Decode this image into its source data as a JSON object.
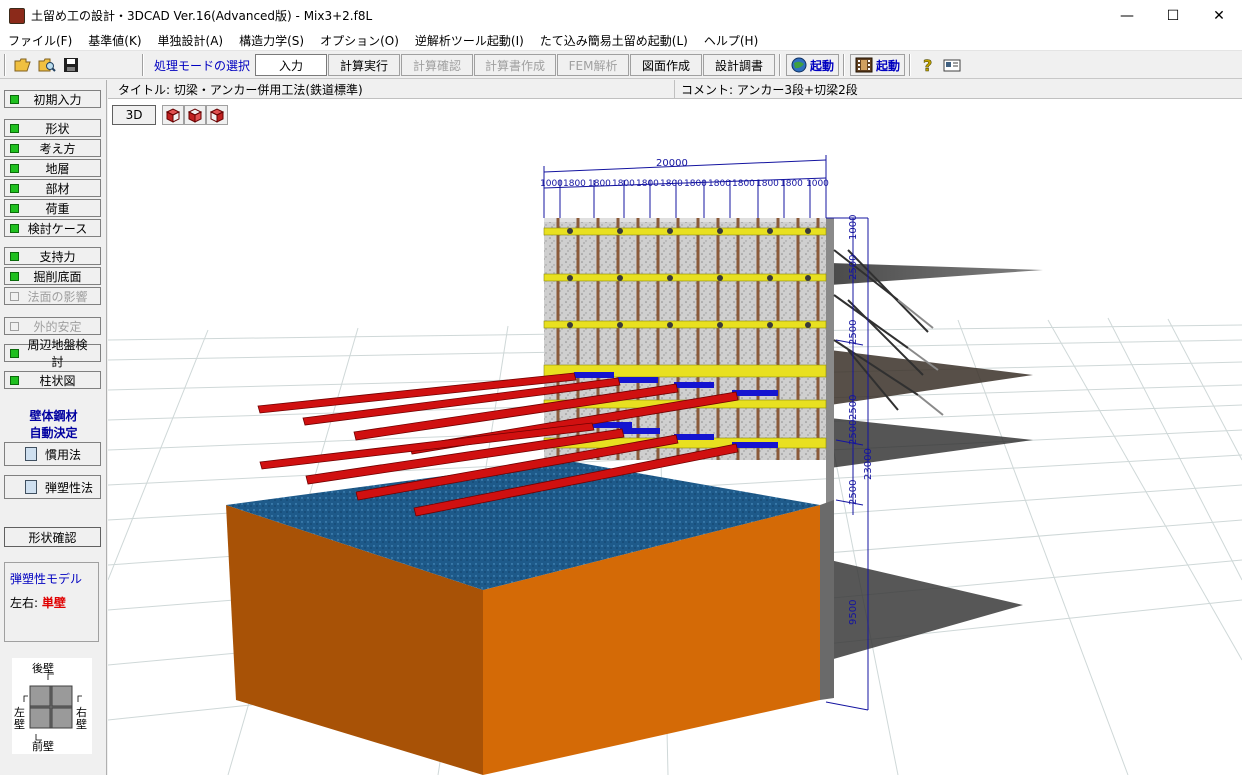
{
  "window": {
    "title": "土留め工の設計・3DCAD Ver.16(Advanced版) - Mix3+2.f8L",
    "minimize": "—",
    "maximize": "☐",
    "close": "✕"
  },
  "menu": [
    {
      "label": "ファイル(F)"
    },
    {
      "label": "基準値(K)"
    },
    {
      "label": "単独設計(A)"
    },
    {
      "label": "構造力学(S)"
    },
    {
      "label": "オプション(O)"
    },
    {
      "label": "逆解析ツール起動(I)"
    },
    {
      "label": "たて込み簡易土留め起動(L)"
    },
    {
      "label": "ヘルプ(H)"
    }
  ],
  "toolbar": {
    "mode_label": "処理モードの選択",
    "buttons": [
      {
        "label": "入力",
        "state": "active"
      },
      {
        "label": "計算実行",
        "state": "normal"
      },
      {
        "label": "計算確認",
        "state": "disabled"
      },
      {
        "label": "計算書作成",
        "state": "disabled"
      },
      {
        "label": "FEM解析",
        "state": "disabled"
      },
      {
        "label": "図面作成",
        "state": "normal"
      },
      {
        "label": "設計調書",
        "state": "normal"
      }
    ],
    "launch1": "起動",
    "launch2": "起動"
  },
  "sidebar": {
    "initial": "初期入力",
    "group1": [
      "形状",
      "考え方",
      "地層",
      "部材",
      "荷重",
      "検討ケース"
    ],
    "group2": [
      "支持力",
      "掘削底面",
      "法面の影響"
    ],
    "external": "外的安定",
    "peripheral": "周辺地盤検討",
    "column": "柱状図",
    "auto_label_1": "壁体鋼材",
    "auto_label_2": "自動決定",
    "conventional": "慣用法",
    "elastoplastic": "弾塑性法",
    "shape_check": "形状確認",
    "model_title": "弾塑性モデル",
    "model_lr_label": "左右:",
    "model_lr_value": "単壁",
    "wall_back": "後壁",
    "wall_front": "前壁",
    "wall_left": "左壁",
    "wall_right": "右壁"
  },
  "info": {
    "title": "タイトル: 切梁・アンカー併用工法(鉄道標準)",
    "comment": "コメント: アンカー3段+切梁2段"
  },
  "view": {
    "btn3d": "3D"
  },
  "dims": {
    "top_total": "20000",
    "top_segments": [
      "1000",
      "1800",
      "1800",
      "1800",
      "1800",
      "1800",
      "1800",
      "1800",
      "1800",
      "1800",
      "1800",
      "1000"
    ],
    "side_1000": "1000",
    "side_2500_a": "2500",
    "side_2500_b": "2500",
    "side_2500_c": "2500",
    "side_2500_d": "2500",
    "side_2500_e": "2500",
    "side_23000": "23000",
    "side_9500": "9500"
  },
  "colors": {
    "accent_blue": "#0000c0",
    "red_strut": "#d01010",
    "wale_yellow": "#e8e020",
    "soil_orange": "#d06a08",
    "water_blue": "#1e5a8a",
    "led_green": "#20c020"
  }
}
